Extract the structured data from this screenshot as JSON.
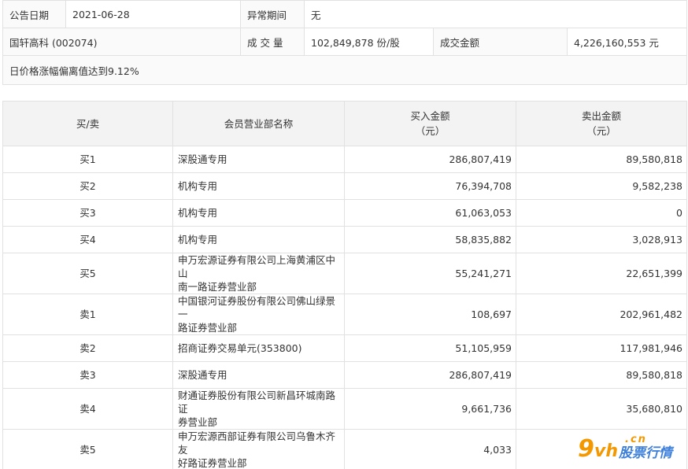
{
  "info": {
    "date_label": "公告日期",
    "date_value": "2021-06-28",
    "abnormal_label": "异常期间",
    "abnormal_value": "无",
    "stock_name": "国轩高科 (002074)",
    "volume_label": "成 交 量",
    "volume_value": "102,849,878 份/股",
    "amount_label": "成交金额",
    "amount_value": "4,226,160,553 元",
    "reason": "日价格涨幅偏离值达到9.12%"
  },
  "table": {
    "headers": {
      "side": "买/卖",
      "broker": "会员营业部名称",
      "buy_line1": "买入金额",
      "buy_line2": "（元）",
      "sell_line1": "卖出金额",
      "sell_line2": "（元）"
    },
    "rows": [
      {
        "side": "买1",
        "broker": "深股通专用",
        "buy": "286,807,419",
        "sell": "89,580,818"
      },
      {
        "side": "买2",
        "broker": "机构专用",
        "buy": "76,394,708",
        "sell": "9,582,238"
      },
      {
        "side": "买3",
        "broker": "机构专用",
        "buy": "61,063,053",
        "sell": "0"
      },
      {
        "side": "买4",
        "broker": "机构专用",
        "buy": "58,835,882",
        "sell": "3,028,913"
      },
      {
        "side": "买5",
        "broker_line1": "申万宏源证券有限公司上海黄浦区中山",
        "broker_line2": "南一路证券营业部",
        "buy": "55,241,271",
        "sell": "22,651,399"
      },
      {
        "side": "卖1",
        "broker_line1": "中国银河证券股份有限公司佛山绿景一",
        "broker_line2": "路证券营业部",
        "buy": "108,697",
        "sell": "202,961,482"
      },
      {
        "side": "卖2",
        "broker": "招商证券交易单元(353800)",
        "buy": "51,105,959",
        "sell": "117,981,946"
      },
      {
        "side": "卖3",
        "broker": "深股通专用",
        "buy": "286,807,419",
        "sell": "89,580,818"
      },
      {
        "side": "卖4",
        "broker_line1": "财通证券股份有限公司新昌环城南路证",
        "broker_line2": "券营业部",
        "buy": "9,661,736",
        "sell": "35,680,810"
      },
      {
        "side": "卖5",
        "broker_line1": "申万宏源西部证券有限公司乌鲁木齐友",
        "broker_line2": "好路证券营业部",
        "buy": "4,033",
        "sell": ""
      }
    ]
  },
  "watermark": {
    "nine": "9",
    "vh": "vh",
    "cn": ".cn",
    "tag": "股票行情"
  }
}
